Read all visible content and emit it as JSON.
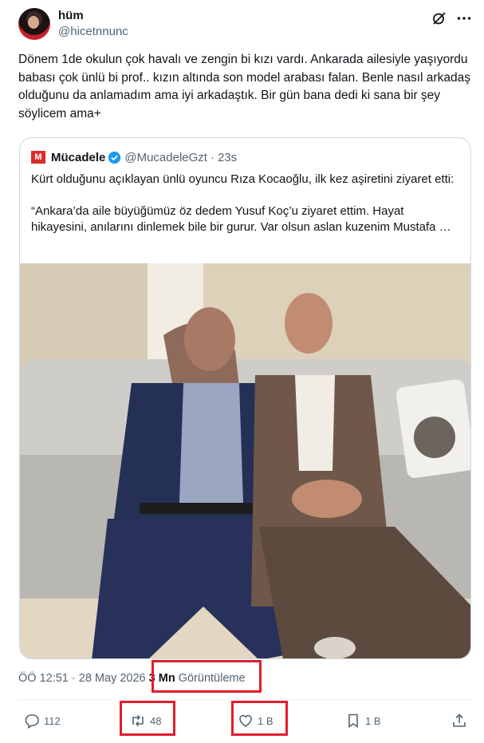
{
  "author": {
    "name": "hüm",
    "handle": "@hicetnnunc"
  },
  "tweet": {
    "text": "Dönem 1de okulun çok havalı ve zengin bi kızı vardı. Ankarada ailesiyle yaşıyordu babası çok ünlü bi prof.. kızın altında son model arabası falan. Benle nasıl arkadaş olduğunu da anlamadım ama iyi arkadaştık. Bir gün bana dedi ki sana bir şey söylicem ama+"
  },
  "quote": {
    "logo_text": "M",
    "name": "Mücadele",
    "handle": "@MucadeleGzt",
    "separator": "·",
    "time": "23s",
    "text": "Kürt olduğunu açıklayan ünlü oyuncu Rıza Kocaoğlu, ilk kez aşiretini ziyaret etti:\n\n“Ankara’da aile büyüğümüz öz dedem Yusuf Koç’u ziyaret ettim. Hayat hikayesini, anılarını dinlemek bile bir gurur. Var olsun aslan kuzenim Mustafa …"
  },
  "meta": {
    "time": "ÖÖ 12:51",
    "separator": "·",
    "date": "28 May 2026",
    "views_count": "3 Mn",
    "views_label": "Görüntüleme"
  },
  "actions": {
    "replies": "112",
    "reposts": "48",
    "likes": "1 B",
    "bookmarks": "1 B"
  },
  "colors": {
    "highlight_box": "#e11d2b",
    "secondary_text": "#536471",
    "verified": "#1d9bf0"
  },
  "icons": [
    "grok-icon",
    "more-icon",
    "verified-icon",
    "reply-icon",
    "repost-icon",
    "like-icon",
    "bookmark-icon",
    "share-icon"
  ]
}
